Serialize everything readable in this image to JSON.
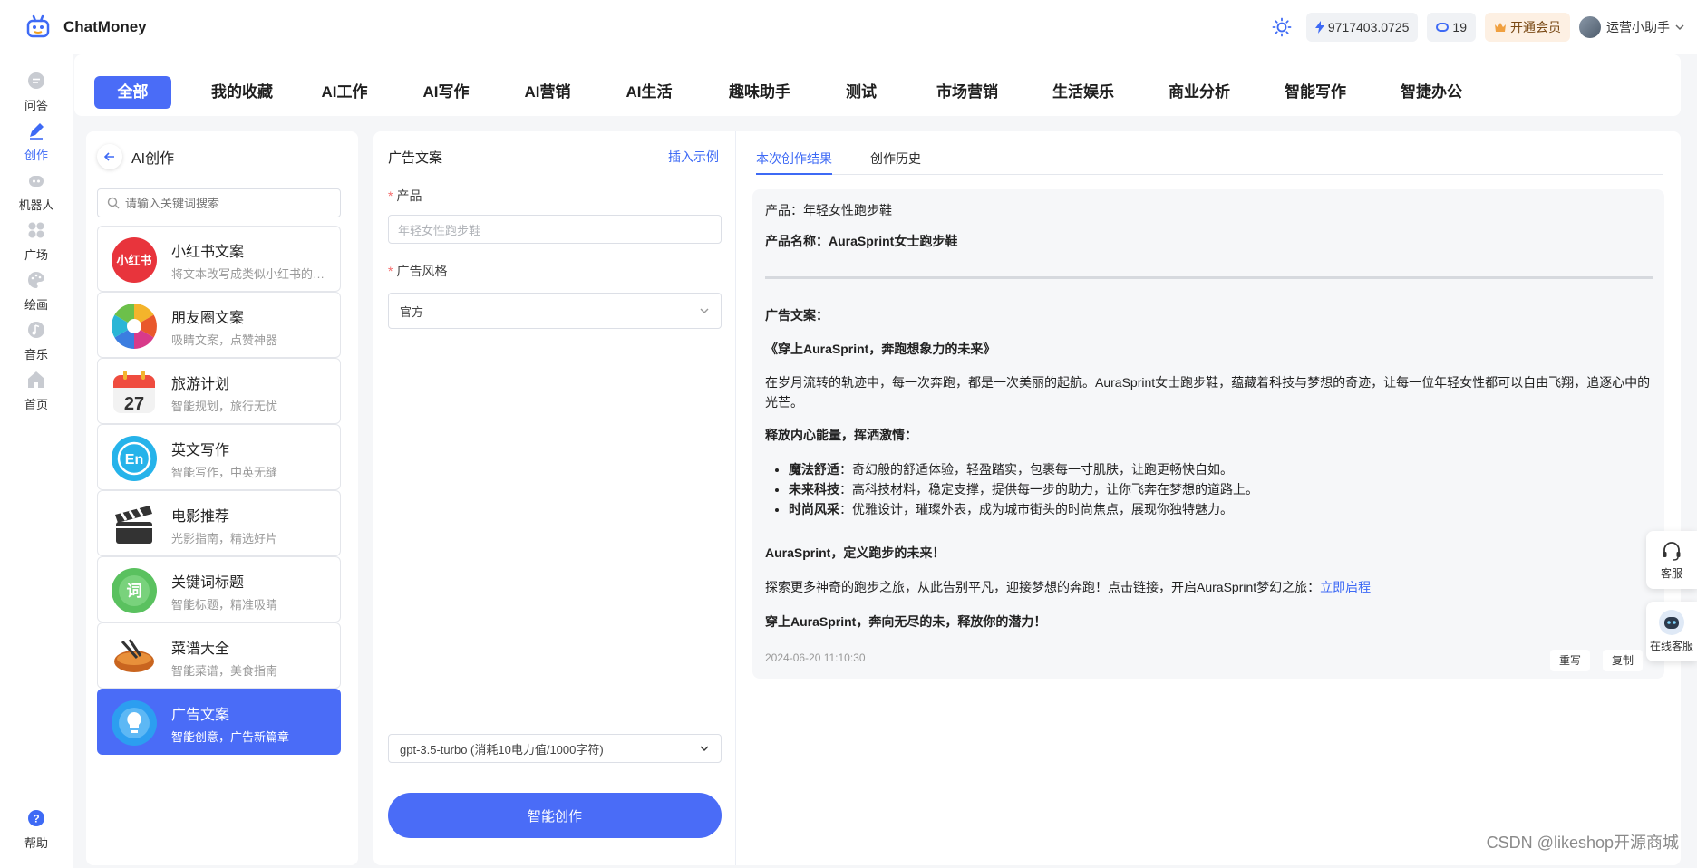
{
  "app": {
    "name": "ChatMoney"
  },
  "header": {
    "balance": "9717403.0725",
    "tokens": "19",
    "vip_label": "开通会员",
    "user_name": "运营小助手"
  },
  "rail": [
    {
      "label": "问答",
      "icon": "chat-icon"
    },
    {
      "label": "创作",
      "icon": "pen-icon"
    },
    {
      "label": "机器人",
      "icon": "robot-icon"
    },
    {
      "label": "广场",
      "icon": "grid-icon"
    },
    {
      "label": "绘画",
      "icon": "palette-icon"
    },
    {
      "label": "音乐",
      "icon": "music-icon"
    },
    {
      "label": "首页",
      "icon": "home-icon"
    },
    {
      "label": "帮助",
      "icon": "help-icon"
    }
  ],
  "categories": [
    "全部",
    "我的收藏",
    "AI工作",
    "AI写作",
    "AI营销",
    "AI生活",
    "趣味助手",
    "测试",
    "市场营销",
    "生活娱乐",
    "商业分析",
    "智能写作",
    "智捷办公"
  ],
  "toolpanel": {
    "title": "AI创作",
    "search_placeholder": "请输入关键词搜索",
    "tools": [
      {
        "name": "小红书文案",
        "desc": "将文本改写成类似小红书的Emoji风格",
        "icon_color": "#e8343c"
      },
      {
        "name": "朋友圈文案",
        "desc": "吸睛文案，点赞神器",
        "icon_color": "#f3a52b"
      },
      {
        "name": "旅游计划",
        "desc": "智能规划，旅行无忧",
        "icon_color": "#ef4c3f"
      },
      {
        "name": "英文写作",
        "desc": "智能写作，中英无缝",
        "icon_color": "#26b3ea"
      },
      {
        "name": "电影推荐",
        "desc": "光影指南，精选好片",
        "icon_color": "#333333"
      },
      {
        "name": "关键词标题",
        "desc": "智能标题，精准吸睛",
        "icon_color": "#5ac15f"
      },
      {
        "name": "菜谱大全",
        "desc": "智能菜谱，美食指南",
        "icon_color": "#c9651f"
      },
      {
        "name": "广告文案",
        "desc": "智能创意，广告新篇章",
        "icon_color": "#2c9ef0"
      }
    ]
  },
  "form": {
    "title": "广告文案",
    "insert_example": "插入示例",
    "product_label": "产品",
    "product_placeholder": "年轻女性跑步鞋",
    "style_label": "广告风格",
    "style_value": "官方",
    "model_value": "gpt-3.5-turbo (消耗10电力值/1000字符)",
    "generate_label": "智能创作"
  },
  "result": {
    "tab_current": "本次创作结果",
    "tab_history": "创作历史",
    "line_product": "产品：年轻女性跑步鞋",
    "line_product_name": "产品名称：AuraSprint女士跑步鞋",
    "ad_heading": "广告文案：",
    "ad_title": "《穿上AuraSprint，奔跑想象力的未来》",
    "para1": "在岁月流转的轨迹中，每一次奔跑，都是一次美丽的起航。AuraSprint女士跑步鞋，蕴藏着科技与梦想的奇迹，让每一位年轻女性都可以自由飞翔，追逐心中的光芒。",
    "section_heading": "释放内心能量，挥洒激情：",
    "bullets": [
      {
        "bold": "魔法舒适",
        "text": "：奇幻般的舒适体验，轻盈踏实，包裹每一寸肌肤，让跑更畅快自如。"
      },
      {
        "bold": "未来科技",
        "text": "：高科技材料，稳定支撑，提供每一步的助力，让你飞奔在梦想的道路上。"
      },
      {
        "bold": "时尚风采",
        "text": "：优雅设计，璀璨外表，成为城市街头的时尚焦点，展现你独特魅力。"
      }
    ],
    "slogan": "AuraSprint，定义跑步的未来！",
    "explore": "探索更多神奇的跑步之旅，从此告别平凡，迎接梦想的奔跑！点击链接，开启AuraSprint梦幻之旅：",
    "explore_link": "立即启程",
    "closing": "穿上AuraSprint，奔向无尽的未，释放你的潜力！",
    "date": "2024-06-20 11:10:30",
    "rewrite_label": "重写",
    "copy_label": "复制"
  },
  "float": {
    "service_label": "客服",
    "online_label": "在线客服"
  },
  "watermark": "CSDN @likeshop开源商城",
  "colors": {
    "accent": "#4a6cf7",
    "link": "#3e6af5"
  }
}
